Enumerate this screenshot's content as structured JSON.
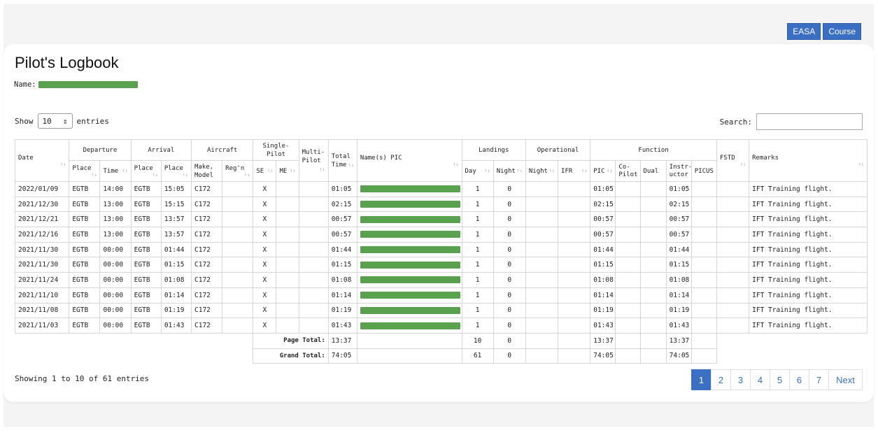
{
  "top_buttons": {
    "easa": "EASA",
    "course": "Course"
  },
  "title": "Pilot's Logbook",
  "name_label": "Name:",
  "show": {
    "prefix": "Show",
    "value": "10",
    "suffix": "entries"
  },
  "search_label": "Search:",
  "headers": {
    "date": "Date",
    "departure": "Departure",
    "arrival": "Arrival",
    "aircraft": "Aircraft",
    "single_pilot": "Single-Pilot",
    "multi_pilot": "Multi-Pilot",
    "total_time": "Total Time",
    "names_pic": "Name(s) PIC",
    "landings": "Landings",
    "operational": "Operational",
    "function": "Function",
    "fstd": "FSTD",
    "remarks": "Remarks",
    "place": "Place",
    "time": "Time",
    "make_model": "Make, Model",
    "regn": "Reg'n",
    "se": "SE",
    "me": "ME",
    "day": "Day",
    "night": "Night",
    "ifr": "IFR",
    "pic": "PIC",
    "co_pilot": "Co-Pilot",
    "dual": "Dual",
    "instructor": "Instr-uctor",
    "picus": "PICUS"
  },
  "rows": [
    {
      "date": "2022/01/09",
      "dep_place": "EGTB",
      "dep_time": "14:00",
      "arr_place": "EGTB",
      "arr_time": "15:05",
      "model": "C172",
      "se": "X",
      "total": "01:05",
      "day": "1",
      "night": "0",
      "pic": "01:05",
      "instr": "01:05",
      "remarks": "IFT Training flight."
    },
    {
      "date": "2021/12/30",
      "dep_place": "EGTB",
      "dep_time": "13:00",
      "arr_place": "EGTB",
      "arr_time": "15:15",
      "model": "C172",
      "se": "X",
      "total": "02:15",
      "day": "1",
      "night": "0",
      "pic": "02:15",
      "instr": "02:15",
      "remarks": "IFT Training flight."
    },
    {
      "date": "2021/12/21",
      "dep_place": "EGTB",
      "dep_time": "13:00",
      "arr_place": "EGTB",
      "arr_time": "13:57",
      "model": "C172",
      "se": "X",
      "total": "00:57",
      "day": "1",
      "night": "0",
      "pic": "00:57",
      "instr": "00:57",
      "remarks": "IFT Training flight."
    },
    {
      "date": "2021/12/16",
      "dep_place": "EGTB",
      "dep_time": "13:00",
      "arr_place": "EGTB",
      "arr_time": "13:57",
      "model": "C172",
      "se": "X",
      "total": "00:57",
      "day": "1",
      "night": "0",
      "pic": "00:57",
      "instr": "00:57",
      "remarks": "IFT Training flight."
    },
    {
      "date": "2021/11/30",
      "dep_place": "EGTB",
      "dep_time": "00:00",
      "arr_place": "EGTB",
      "arr_time": "01:44",
      "model": "C172",
      "se": "X",
      "total": "01:44",
      "day": "1",
      "night": "0",
      "pic": "01:44",
      "instr": "01:44",
      "remarks": "IFT Training flight."
    },
    {
      "date": "2021/11/30",
      "dep_place": "EGTB",
      "dep_time": "00:00",
      "arr_place": "EGTB",
      "arr_time": "01:15",
      "model": "C172",
      "se": "X",
      "total": "01:15",
      "day": "1",
      "night": "0",
      "pic": "01:15",
      "instr": "01:15",
      "remarks": "IFT Training flight."
    },
    {
      "date": "2021/11/24",
      "dep_place": "EGTB",
      "dep_time": "00:00",
      "arr_place": "EGTB",
      "arr_time": "01:08",
      "model": "C172",
      "se": "X",
      "total": "01:08",
      "day": "1",
      "night": "0",
      "pic": "01:08",
      "instr": "01:08",
      "remarks": "IFT Training flight."
    },
    {
      "date": "2021/11/10",
      "dep_place": "EGTB",
      "dep_time": "00:00",
      "arr_place": "EGTB",
      "arr_time": "01:14",
      "model": "C172",
      "se": "X",
      "total": "01:14",
      "day": "1",
      "night": "0",
      "pic": "01:14",
      "instr": "01:14",
      "remarks": "IFT Training flight."
    },
    {
      "date": "2021/11/08",
      "dep_place": "EGTB",
      "dep_time": "00:00",
      "arr_place": "EGTB",
      "arr_time": "01:19",
      "model": "C172",
      "se": "X",
      "total": "01:19",
      "day": "1",
      "night": "0",
      "pic": "01:19",
      "instr": "01:19",
      "remarks": "IFT Training flight."
    },
    {
      "date": "2021/11/03",
      "dep_place": "EGTB",
      "dep_time": "00:00",
      "arr_place": "EGTB",
      "arr_time": "01:43",
      "model": "C172",
      "se": "X",
      "total": "01:43",
      "day": "1",
      "night": "0",
      "pic": "01:43",
      "instr": "01:43",
      "remarks": "IFT Training flight."
    }
  ],
  "page_total": {
    "label": "Page Total:",
    "total": "13:37",
    "day": "10",
    "night": "0",
    "pic": "13:37",
    "instr": "13:37"
  },
  "grand_total": {
    "label": "Grand Total:",
    "total": "74:05",
    "day": "61",
    "night": "0",
    "pic": "74:05",
    "instr": "74:05"
  },
  "info": "Showing 1 to 10 of 61 entries",
  "pages": [
    "1",
    "2",
    "3",
    "4",
    "5",
    "6",
    "7"
  ],
  "next_label": "Next",
  "colors": {
    "accent": "#3b6fc4",
    "redaction": "#5aa14f"
  }
}
